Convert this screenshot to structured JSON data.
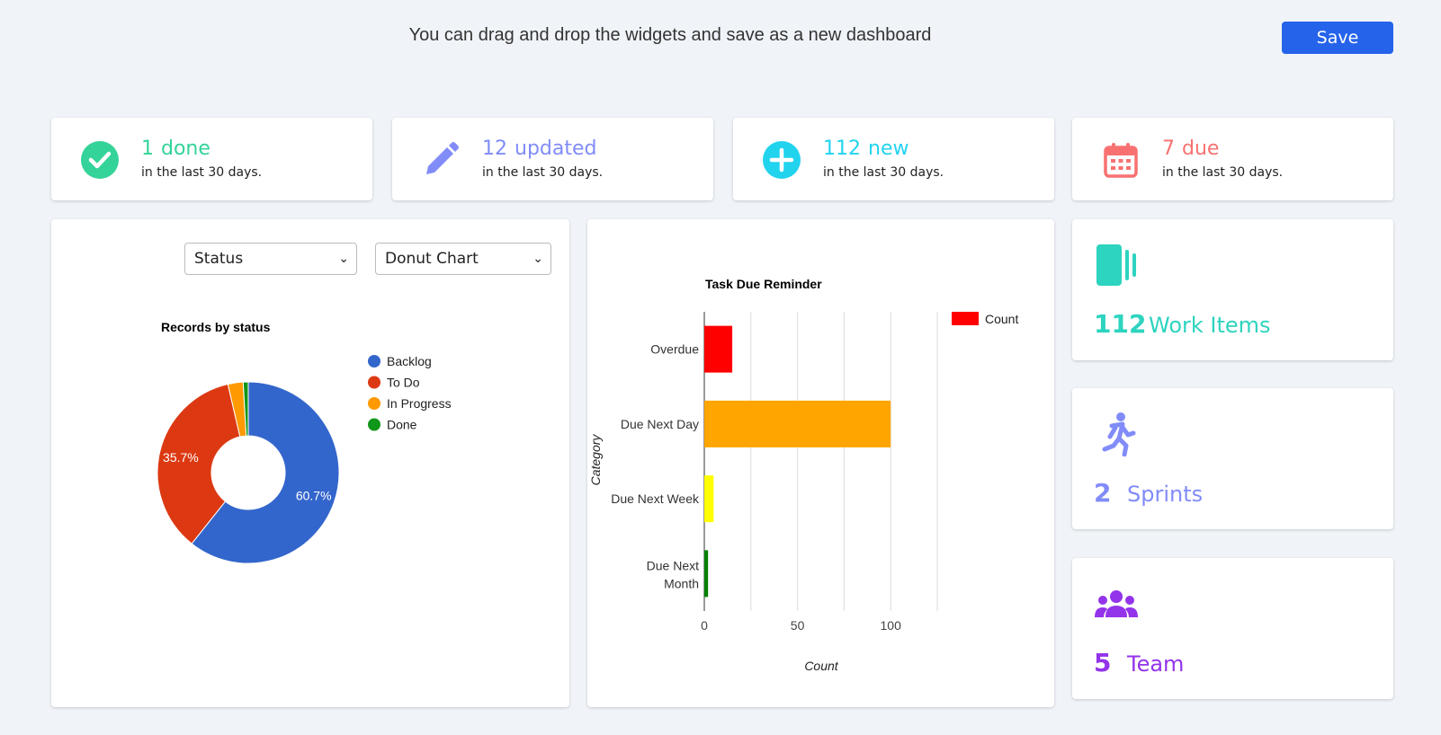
{
  "header": {
    "instruction": "You can drag and drop the widgets and save as a new dashboard",
    "save_label": "Save"
  },
  "stats": [
    {
      "value": "1",
      "label": "done",
      "sub": "in the last 30 days.",
      "color": "#34d399",
      "icon": "check-circle-icon"
    },
    {
      "value": "12",
      "label": "updated",
      "sub": "in the last 30 days.",
      "color": "#818cf8",
      "icon": "pencil-icon"
    },
    {
      "value": "112",
      "label": "new",
      "sub": "in the last 30 days.",
      "color": "#22d3ee",
      "icon": "plus-circle-icon"
    },
    {
      "value": "7",
      "label": "due",
      "sub": "in the last 30 days.",
      "color": "#f87171",
      "icon": "calendar-icon"
    }
  ],
  "side_cards": [
    {
      "value": "112",
      "label": "Work Items",
      "color": "#2dd4bf",
      "icon": "work-items-icon"
    },
    {
      "value": "2",
      "label": "Sprints",
      "color": "#818cf8",
      "icon": "running-person-icon"
    },
    {
      "value": "5",
      "label": "Team",
      "color": "#9333ea",
      "icon": "team-icon"
    }
  ],
  "donut_controls": {
    "group_by": "Status",
    "chart_type": "Donut Chart"
  },
  "chart_data": [
    {
      "type": "pie",
      "title": "Records by status",
      "donut": true,
      "categories": [
        "Backlog",
        "To Do",
        "In Progress",
        "Done"
      ],
      "values": [
        60.7,
        35.7,
        2.7,
        0.9
      ],
      "colors": [
        "#3366cc",
        "#dc3912",
        "#ff9900",
        "#109618"
      ],
      "slice_labels": [
        "60.7%",
        "35.7%",
        "",
        ""
      ],
      "legend": "right"
    },
    {
      "type": "bar",
      "orientation": "horizontal",
      "title": "Task Due Reminder",
      "categories": [
        "Overdue",
        "Due Next Day",
        "Due Next Week",
        "Due Next Month"
      ],
      "series": [
        {
          "name": "Count",
          "values": [
            15,
            100,
            5,
            2
          ]
        }
      ],
      "bar_colors": [
        "#ff0000",
        "#ffa500",
        "#ffff00",
        "#008000"
      ],
      "legend_color": "#ff0000",
      "xlabel": "Count",
      "ylabel": "Category",
      "xlim": [
        0,
        125
      ],
      "xticks": [
        "0",
        "50",
        "100"
      ],
      "grid": true,
      "legend": "top-right"
    }
  ]
}
